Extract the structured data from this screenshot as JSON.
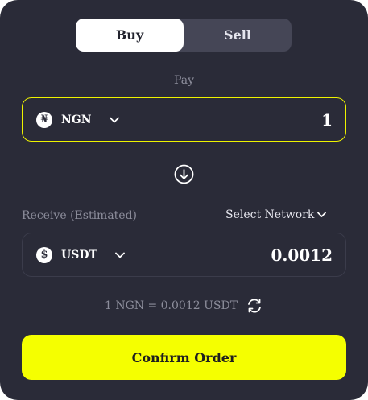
{
  "toggle": {
    "buy_label": "Buy",
    "sell_label": "Sell",
    "active": "Buy"
  },
  "pay": {
    "label": "Pay",
    "currency_icon": "naira-icon",
    "currency_symbol": "₦",
    "currency_code": "NGN",
    "amount": "1"
  },
  "receive": {
    "label": "Receive (Estimated)",
    "network_label": "Select Network",
    "currency_icon": "dollar-icon",
    "currency_symbol": "$",
    "currency_code": "USDT",
    "amount": "0.0012"
  },
  "rate": {
    "text": "1 NGN = 0.0012 USDT"
  },
  "confirm_label": "Confirm Order",
  "colors": {
    "card_bg": "#2a2b38",
    "accent": "#f5ff00",
    "pay_border": "#eef300",
    "muted_text": "#8c8d9b"
  }
}
